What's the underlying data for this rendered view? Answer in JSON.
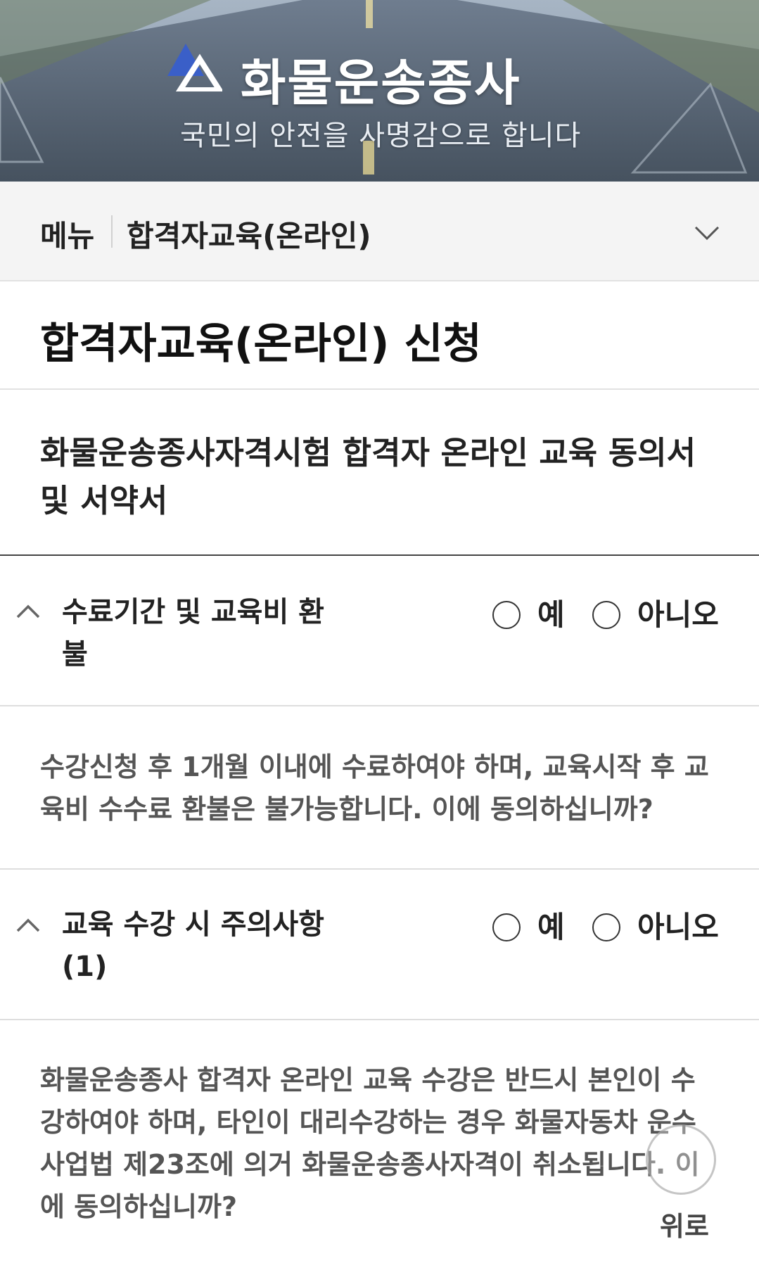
{
  "banner": {
    "title": "화물운송종사",
    "subtitle": "국민의 안전을 사명감으로 합니다",
    "logo_icon": "triangle-logo-icon"
  },
  "menu": {
    "label": "메뉴",
    "current": "합격자교육(온라인)",
    "toggle_icon": "chevron-down-icon"
  },
  "page_title": "합격자교육(온라인) 신청",
  "section_heading": "화물운송종사자격시험 합격자 온라인 교육 동의서 및 서약서",
  "questions": [
    {
      "title": "수료기간 및 교육비 환불",
      "yes_label": "예",
      "no_label": "아니오",
      "body": "수강신청 후 1개월 이내에 수료하여야 하며, 교육시작 후 교육비 수수료 환불은 불가능합니다. 이에 동의하십니까?"
    },
    {
      "title": "교육 수강 시 주의사항(1)",
      "yes_label": "예",
      "no_label": "아니오",
      "body": "화물운송종사 합격자 온라인 교육 수강은 반드시 본인이 수강하여야 하며, 타인이 대리수강하는 경우 화물자동차 운수사업법 제23조에 의거 화물운송종사자격이 취소됩니다. 이에 동의하십니까?"
    }
  ],
  "scroll_top": {
    "label": "위로"
  },
  "colors": {
    "banner_sky": "#8fa0b3",
    "banner_road": "#4e5d70",
    "menu_bg": "#f4f4f4",
    "text_dark": "#222222",
    "text_body": "#555555",
    "logo_blue": "#3a5fc8"
  }
}
